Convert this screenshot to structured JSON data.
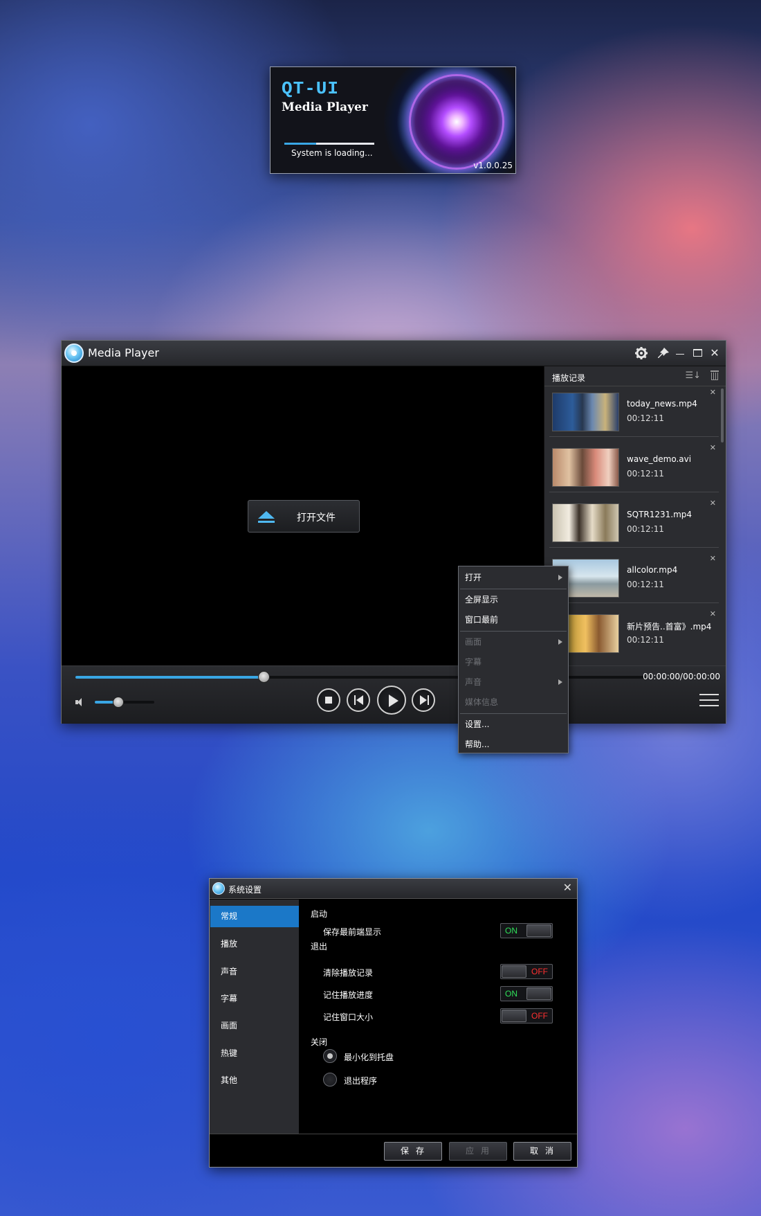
{
  "splash": {
    "logo": "QT-UI",
    "title": "Media Player",
    "status": "System is loading...",
    "version": "v1.0.0.25"
  },
  "player": {
    "title": "Media Player",
    "open_file_label": "打开文件",
    "playlist": {
      "title": "播放记录",
      "items": [
        {
          "name": "today_news.mp4",
          "duration": "00:12:11"
        },
        {
          "name": "wave_demo.avi",
          "duration": "00:12:11"
        },
        {
          "name": "SQTR1231.mp4",
          "duration": "00:12:11"
        },
        {
          "name": "allcolor.mp4",
          "duration": "00:12:11"
        },
        {
          "name": "新片预告..首富》.mp4",
          "duration": "00:12:11"
        }
      ]
    },
    "controls": {
      "time": "00:00:00/00:00:00",
      "seek_progress": 0.33,
      "volume": 0.4
    },
    "context_menu": {
      "items": [
        {
          "label": "打开"
        },
        {
          "label": "全屏显示"
        },
        {
          "label": "窗口最前"
        },
        {
          "label": "画面"
        },
        {
          "label": "字幕"
        },
        {
          "label": "声音"
        },
        {
          "label": "媒体信息"
        },
        {
          "label": "设置..."
        },
        {
          "label": "帮助..."
        }
      ]
    }
  },
  "settings": {
    "title": "系统设置",
    "nav": [
      "常规",
      "播放",
      "声音",
      "字幕",
      "画面",
      "热键",
      "其他"
    ],
    "sections": {
      "startup": "启动",
      "exit": "退出",
      "close": "关闭"
    },
    "options": {
      "keep_on_top": {
        "label": "保存最前端显示",
        "state": "ON"
      },
      "clear_history": {
        "label": "清除播放记录",
        "state": "OFF"
      },
      "remember_progress": {
        "label": "记住播放进度",
        "state": "ON"
      },
      "remember_size": {
        "label": "记住窗口大小",
        "state": "OFF"
      }
    },
    "close_actions": {
      "minimize": "最小化到托盘",
      "quit": "退出程序"
    },
    "buttons": {
      "save": "保存",
      "apply": "应用",
      "cancel": "取消"
    }
  }
}
